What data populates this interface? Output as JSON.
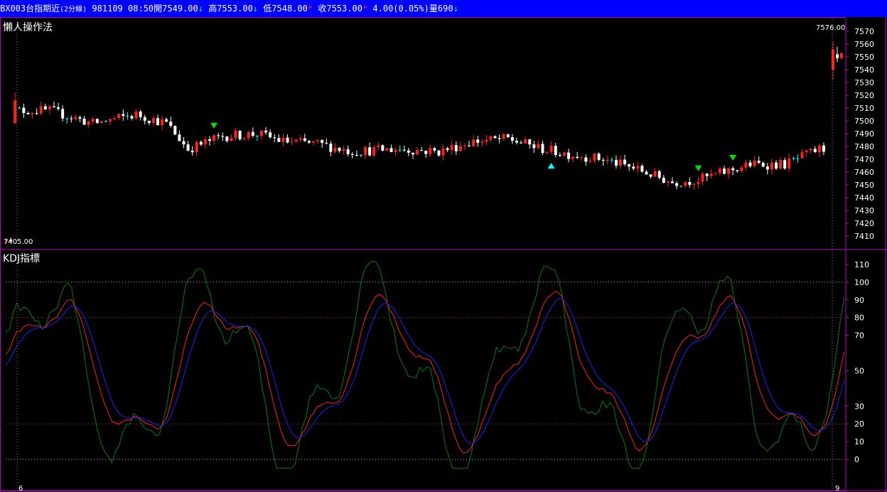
{
  "header": {
    "symbol": "BX003台指期近",
    "period": "(2分線)",
    "date": "981109",
    "time": "08:50",
    "open_label": "開",
    "open": "7549.00",
    "high_label": "高",
    "high": "7553.00",
    "low_label": "低",
    "low": "7548.00",
    "close_label": "收",
    "close": "7553.00",
    "change": "4.00",
    "change_pct": "(0.05%)",
    "volume_label": "量",
    "volume": "690",
    "arrow_down": "↓",
    "arrow_up": "*"
  },
  "colors": {
    "up": "#ff2020",
    "down": "#ffffff",
    "flat": "#00ffff",
    "k": "#ff2020",
    "d": "#2020ff",
    "j": "#008000",
    "frame": "#c000c0",
    "buy": "#00ffff",
    "sell": "#00e000"
  },
  "price_panel": {
    "title": "懶人操作法",
    "max_label": "7576.00",
    "min_label": "7405.00",
    "y_ticks": [
      7570,
      7560,
      7550,
      7540,
      7530,
      7520,
      7510,
      7500,
      7490,
      7480,
      7470,
      7460,
      7450,
      7440,
      7430,
      7420,
      7410
    ]
  },
  "kdj_panel": {
    "title": "KDJ指標",
    "y_ticks": [
      110,
      100,
      90,
      80,
      70,
      50,
      30,
      20,
      10,
      0
    ],
    "ref_lines": [
      100,
      80,
      20,
      0
    ]
  },
  "x_axis": {
    "day_labels": [
      "6",
      "9"
    ]
  },
  "chart_data": {
    "type": "candlestick",
    "series": [
      {
        "name": "K",
        "values": []
      },
      {
        "name": "D",
        "values": []
      },
      {
        "name": "J",
        "values": []
      }
    ]
  }
}
